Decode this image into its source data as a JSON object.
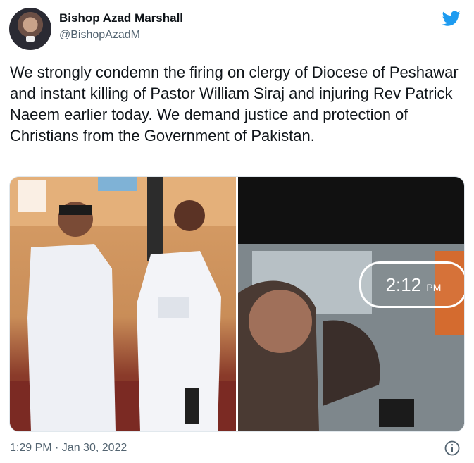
{
  "author": {
    "name": "Bishop Azad Marshall",
    "handle": "@BishopAzadM"
  },
  "tweet": {
    "text": "We strongly condemn the firing on clergy of Diocese of Peshawar and instant killing of Pastor William Siraj and injuring Rev Patrick Naeem earlier today. We demand justice and protection of Christians from the Government of Pakistan.",
    "timestamp": "1:29 PM · Jan 30, 2022"
  },
  "media": {
    "right_photo_overlay": {
      "time": "2:12",
      "ampm": "PM"
    }
  },
  "icons": {
    "brand": "twitter-bird",
    "info": "info-circle"
  },
  "colors": {
    "twitter_blue": "#1d9bf0",
    "secondary_text": "#536471"
  }
}
